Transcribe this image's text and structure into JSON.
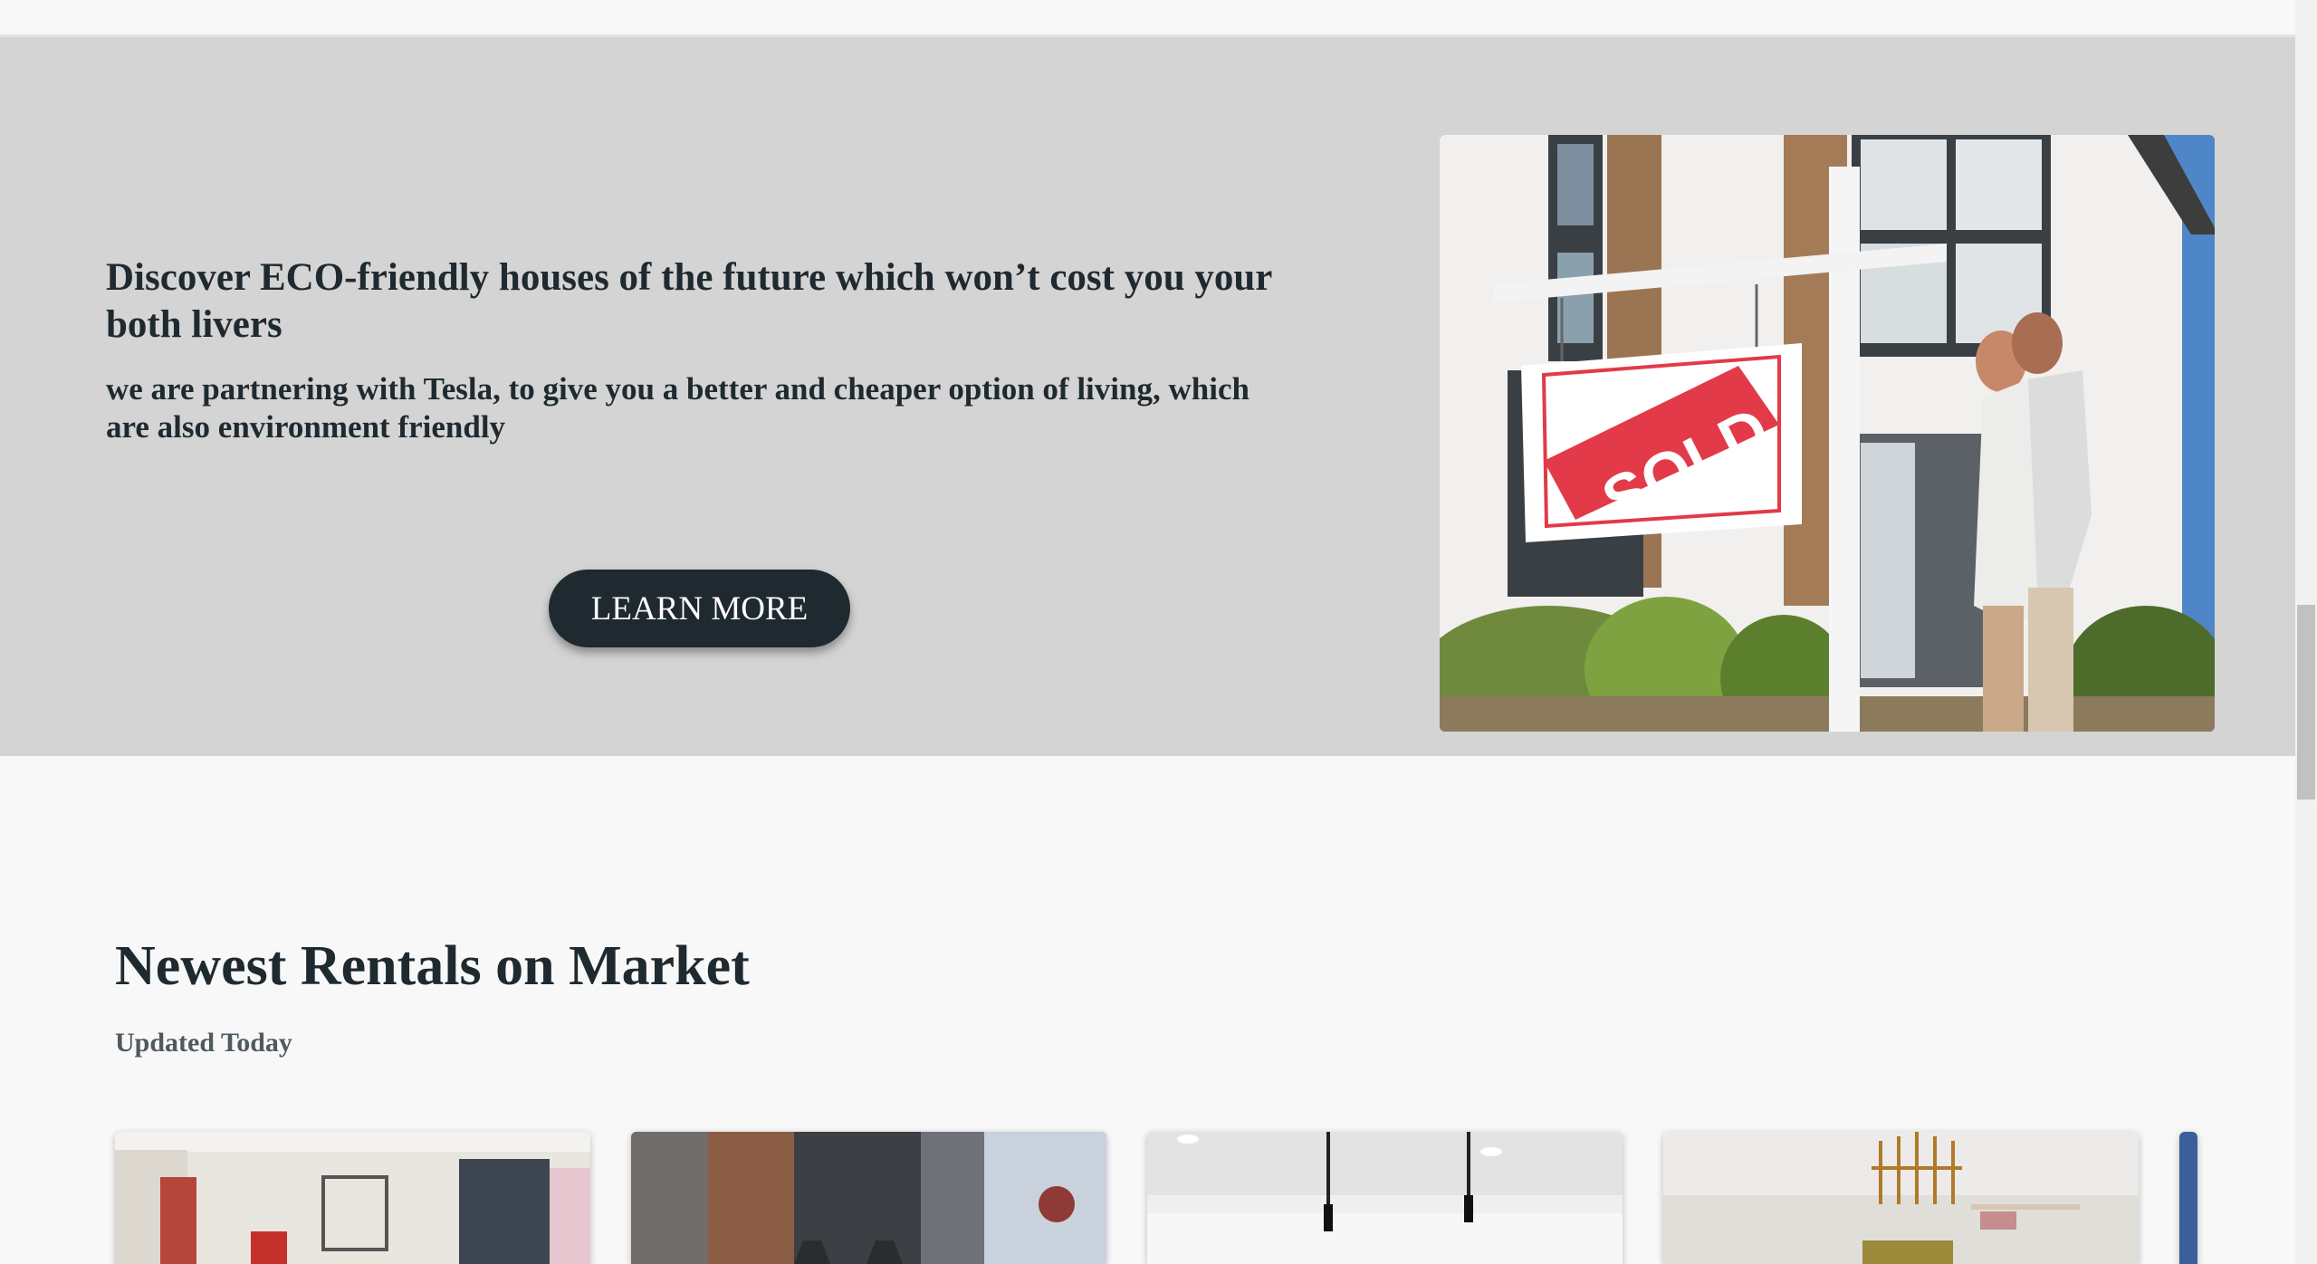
{
  "hero": {
    "title": "Discover ECO-friendly houses of the future which won’t cost you your both livers",
    "subtitle": "we are partnering with Tesla, to give you a better and cheaper option of living, which are also environment friendly",
    "button_label": "LEARN MORE",
    "image_sign_text": "SOLD"
  },
  "rentals": {
    "title": "Newest Rentals on Market",
    "subtitle": "Updated Today"
  },
  "colors": {
    "hero_bg": "#d4d4d4",
    "page_bg": "#f8f8f9",
    "primary_dark": "#1f2a30",
    "sold_red": "#e23a48"
  }
}
